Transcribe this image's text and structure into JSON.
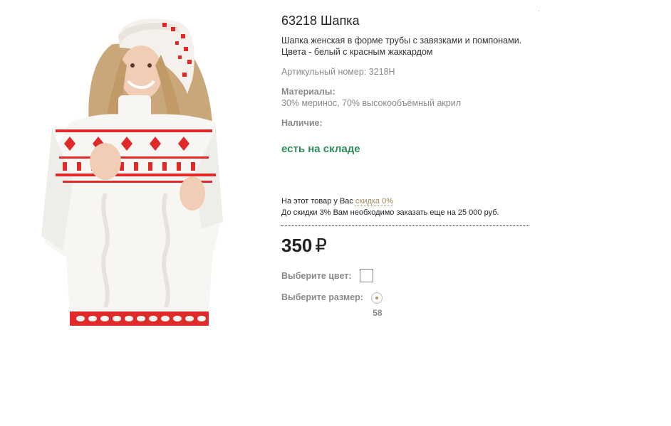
{
  "product": {
    "title": "63218 Шапка",
    "description_line1": "Шапка женская в форме трубы с завязками и помпонами.",
    "description_line2": "Цвета - белый с красным жаккардом",
    "article": "Артикульный номер: 3218Н",
    "materials_label": "Материалы:",
    "materials_value": "30% меринос, 70% высокообъёмный акрил",
    "availability_label": "Наличие:",
    "availability_value": "есть на складе",
    "image_icon": "model-photo"
  },
  "discount": {
    "text": "На этот товар у Вас",
    "link": "скидка 0%",
    "note": "До скидки 3% Вам необходимо заказать еще на 25 000 руб."
  },
  "price": {
    "value": "350",
    "currency": "₽"
  },
  "options": {
    "color_label": "Выберите цвет:",
    "size_label": "Выберите размер:",
    "sizes": [
      "58"
    ]
  },
  "colors": {
    "accent_green": "#2e8b57",
    "jacquard_red": "#e02a2a",
    "link_gold": "#a08a5c"
  }
}
